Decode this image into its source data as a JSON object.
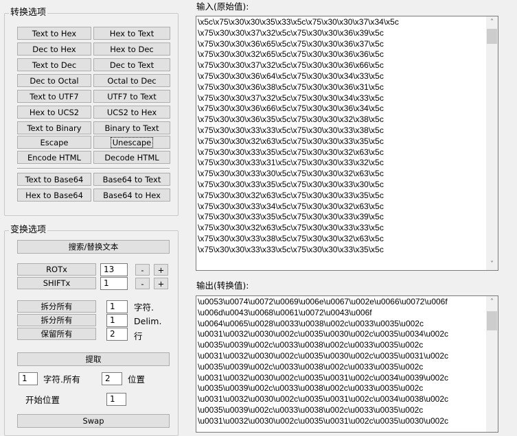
{
  "convert_options": {
    "title": "转换选项",
    "buttons": [
      [
        "Text to Hex",
        "Hex to Text"
      ],
      [
        "Dec to Hex",
        "Hex to Dec"
      ],
      [
        "Text to Dec",
        "Dec to Text"
      ],
      [
        "Dec to Octal",
        "Octal to Dec"
      ],
      [
        "Text to UTF7",
        "UTF7 to Text"
      ],
      [
        "Hex to UCS2",
        "UCS2 to Hex"
      ],
      [
        "Text to Binary",
        "Binary to Text"
      ],
      [
        "Escape",
        "Unescape"
      ],
      [
        "Encode HTML",
        "Decode HTML"
      ],
      [
        "Text to Base64",
        "Base64 to Text"
      ],
      [
        "Hex to Base64",
        "Base64 to Hex"
      ]
    ]
  },
  "transform_options": {
    "title": "变换选项",
    "search_replace_label": "搜索/替换文本",
    "rotx_label": "ROTx",
    "rotx_value": "13",
    "shiftx_label": "SHIFTx",
    "shiftx_value": "1",
    "minus_label": "-",
    "plus_label": "+",
    "split_char_label": "拆分所有",
    "split_char_value": "1",
    "split_char_unit": "字符.",
    "split_delim_label": "拆分所有",
    "split_delim_value": "1",
    "split_delim_unit": "Delim.",
    "keep_label": "保留所有",
    "keep_value": "2",
    "keep_unit": "行",
    "extract_label": "提取",
    "extract_count_value": "1",
    "extract_count_unit": "字符.所有",
    "extract_pos_value": "2",
    "extract_pos_unit": "位置",
    "start_pos_label": "开始位置",
    "start_pos_value": "1",
    "swap_label": "Swap"
  },
  "input": {
    "label": "输入(原始值):",
    "lines": [
      "\\x5c\\x75\\x30\\x30\\x35\\x33\\x5c\\x75\\x30\\x30\\x37\\x34\\x5c",
      "\\x75\\x30\\x30\\x37\\x32\\x5c\\x75\\x30\\x30\\x36\\x39\\x5c",
      "\\x75\\x30\\x30\\x36\\x65\\x5c\\x75\\x30\\x30\\x36\\x37\\x5c",
      "\\x75\\x30\\x30\\x32\\x65\\x5c\\x75\\x30\\x30\\x36\\x36\\x5c",
      "\\x75\\x30\\x30\\x37\\x32\\x5c\\x75\\x30\\x30\\x36\\x66\\x5c",
      "\\x75\\x30\\x30\\x36\\x64\\x5c\\x75\\x30\\x30\\x34\\x33\\x5c",
      "\\x75\\x30\\x30\\x36\\x38\\x5c\\x75\\x30\\x30\\x36\\x31\\x5c",
      "\\x75\\x30\\x30\\x37\\x32\\x5c\\x75\\x30\\x30\\x34\\x33\\x5c",
      "\\x75\\x30\\x30\\x36\\x66\\x5c\\x75\\x30\\x30\\x36\\x34\\x5c",
      "\\x75\\x30\\x30\\x36\\x35\\x5c\\x75\\x30\\x30\\x32\\x38\\x5c",
      "\\x75\\x30\\x30\\x33\\x33\\x5c\\x75\\x30\\x30\\x33\\x38\\x5c",
      "\\x75\\x30\\x30\\x32\\x63\\x5c\\x75\\x30\\x30\\x33\\x35\\x5c",
      "\\x75\\x30\\x30\\x33\\x35\\x5c\\x75\\x30\\x30\\x32\\x63\\x5c",
      "\\x75\\x30\\x30\\x33\\x31\\x5c\\x75\\x30\\x30\\x33\\x32\\x5c",
      "\\x75\\x30\\x30\\x33\\x30\\x5c\\x75\\x30\\x30\\x32\\x63\\x5c",
      "\\x75\\x30\\x30\\x33\\x35\\x5c\\x75\\x30\\x30\\x33\\x30\\x5c",
      "\\x75\\x30\\x30\\x32\\x63\\x5c\\x75\\x30\\x30\\x33\\x35\\x5c",
      "\\x75\\x30\\x30\\x33\\x34\\x5c\\x75\\x30\\x30\\x32\\x63\\x5c",
      "\\x75\\x30\\x30\\x33\\x35\\x5c\\x75\\x30\\x30\\x33\\x39\\x5c",
      "\\x75\\x30\\x30\\x32\\x63\\x5c\\x75\\x30\\x30\\x33\\x33\\x5c",
      "\\x75\\x30\\x30\\x33\\x38\\x5c\\x75\\x30\\x30\\x32\\x63\\x5c",
      "\\x75\\x30\\x30\\x33\\x33\\x5c\\x75\\x30\\x30\\x33\\x35\\x5c"
    ]
  },
  "output": {
    "label": "输出(转换值):",
    "lines": [
      "\\u0053\\u0074\\u0072\\u0069\\u006e\\u0067\\u002e\\u0066\\u0072\\u006f",
      "\\u006d\\u0043\\u0068\\u0061\\u0072\\u0043\\u006f",
      "\\u0064\\u0065\\u0028\\u0033\\u0038\\u002c\\u0033\\u0035\\u002c",
      "\\u0031\\u0032\\u0030\\u002c\\u0035\\u0030\\u002c\\u0035\\u0034\\u002c",
      "\\u0035\\u0039\\u002c\\u0033\\u0038\\u002c\\u0033\\u0035\\u002c",
      "\\u0031\\u0032\\u0030\\u002c\\u0035\\u0030\\u002c\\u0035\\u0031\\u002c",
      "\\u0035\\u0039\\u002c\\u0033\\u0038\\u002c\\u0033\\u0035\\u002c",
      "\\u0031\\u0032\\u0030\\u002c\\u0035\\u0031\\u002c\\u0034\\u0039\\u002c",
      "\\u0035\\u0039\\u002c\\u0033\\u0038\\u002c\\u0033\\u0035\\u002c",
      "\\u0031\\u0032\\u0030\\u002c\\u0035\\u0031\\u002c\\u0034\\u0038\\u002c",
      "\\u0035\\u0039\\u002c\\u0033\\u0038\\u002c\\u0033\\u0035\\u002c",
      "\\u0031\\u0032\\u0030\\u002c\\u0035\\u0031\\u002c\\u0035\\u0030\\u002c"
    ]
  },
  "icons": {
    "scroll_up": "chevron-up-icon",
    "scroll_down": "chevron-down-icon"
  }
}
